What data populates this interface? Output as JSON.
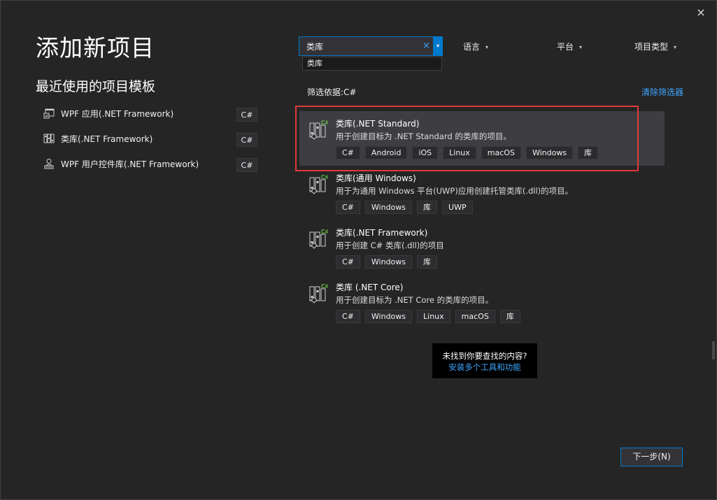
{
  "dialog": {
    "title": "添加新项目",
    "close_icon": "×"
  },
  "recent": {
    "title": "最近使用的项目模板",
    "items": [
      {
        "label": "WPF 应用(.NET Framework)",
        "tag": "C#",
        "icon": "wpf-app-icon"
      },
      {
        "label": "类库(.NET Framework)",
        "tag": "C#",
        "icon": "class-library-icon"
      },
      {
        "label": "WPF 用户控件库(.NET Framework)",
        "tag": "C#",
        "icon": "user-control-library-icon"
      }
    ]
  },
  "search": {
    "value": "类库",
    "clear_icon": "×",
    "dropdown_icon": "▾",
    "suggestion": "类库"
  },
  "filters": {
    "language": "语言",
    "platform": "平台",
    "project_type": "项目类型",
    "caret": "▾",
    "applied_label": "筛选依据:C#",
    "clear_label": "清除筛选器"
  },
  "templates": [
    {
      "name": "类库(.NET Standard)",
      "desc": "用于创建目标为 .NET Standard 的类库的项目。",
      "tags": [
        "C#",
        "Android",
        "iOS",
        "Linux",
        "macOS",
        "Windows",
        "库"
      ],
      "selected": true
    },
    {
      "name": "类库(通用 Windows)",
      "desc": "用于为通用 Windows 平台(UWP)应用创建托管类库(.dll)的项目。",
      "tags": [
        "C#",
        "Windows",
        "库",
        "UWP"
      ],
      "selected": false
    },
    {
      "name": "类库(.NET Framework)",
      "desc": "用于创建 C# 类库(.dll)的项目",
      "tags": [
        "C#",
        "Windows",
        "库"
      ],
      "selected": false
    },
    {
      "name": "类库 (.NET Core)",
      "desc": "用于创建目标为 .NET Core 的类库的项目。",
      "tags": [
        "C#",
        "Windows",
        "Linux",
        "macOS",
        "库"
      ],
      "selected": false
    }
  ],
  "help": {
    "question": "未找到你要查找的内容?",
    "link": "安装多个工具和功能"
  },
  "next_button": "下一步(N)",
  "colors": {
    "background": "#252526",
    "accent": "#007acc",
    "link": "#3ea6ff",
    "highlight": "#e03a3a",
    "selected_bg": "#3e3e42"
  }
}
